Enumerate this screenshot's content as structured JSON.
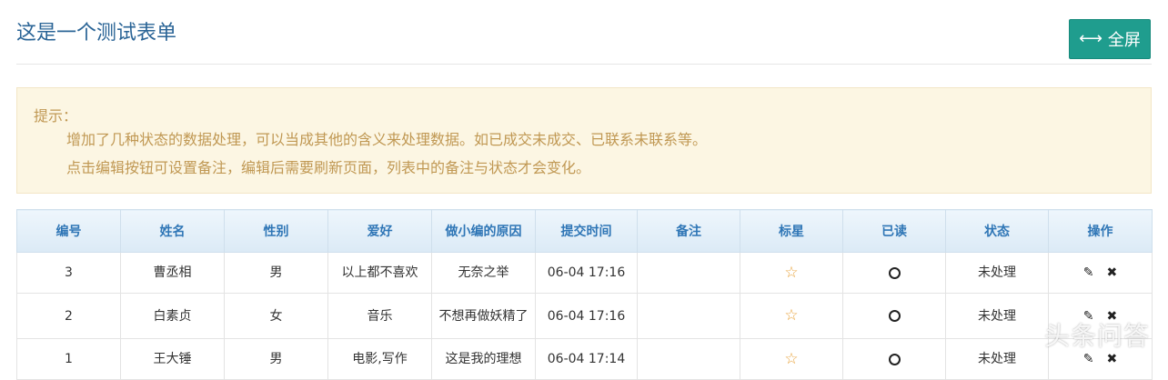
{
  "page": {
    "title": "这是一个测试表单",
    "fullscreen_label": "全屏",
    "fullscreen_icon": "left-right-arrow-icon"
  },
  "notice": {
    "heading": "提示：",
    "lines": [
      "增加了几种状态的数据处理，可以当成其他的含义来处理数据。如已成交未成交、已联系未联系等。",
      "点击编辑按钮可设置备注，编辑后需要刷新页面，列表中的备注与状态才会变化。"
    ]
  },
  "table": {
    "headers": [
      "编号",
      "姓名",
      "性别",
      "爱好",
      "做小编的原因",
      "提交时间",
      "备注",
      "标星",
      "已读",
      "状态",
      "操作"
    ],
    "rows": [
      {
        "id": "3",
        "name": "曹丞相",
        "gender": "男",
        "hobby": "以上都不喜欢",
        "reason": "无奈之举",
        "time": "06-04 17:16",
        "note": "",
        "starred": "☆",
        "read": "",
        "status": "未处理"
      },
      {
        "id": "2",
        "name": "白素贞",
        "gender": "女",
        "hobby": "音乐",
        "reason": "不想再做妖精了",
        "time": "06-04 17:16",
        "note": "",
        "starred": "☆",
        "read": "",
        "status": "未处理"
      },
      {
        "id": "1",
        "name": "王大锤",
        "gender": "男",
        "hobby": "电影,写作",
        "reason": "这是我的理想",
        "time": "06-04 17:14",
        "note": "",
        "starred": "☆",
        "read": "",
        "status": "未处理"
      }
    ],
    "edit_icon": "pencil-icon",
    "delete_icon": "close-icon"
  },
  "watermark": "头条问答",
  "colors": {
    "title": "#2a6496",
    "button_bg": "#1f9d8e",
    "notice_bg": "#fcf6e3",
    "notice_text": "#c09853",
    "header_text": "#2f76b6",
    "star": "#e8a23a"
  }
}
